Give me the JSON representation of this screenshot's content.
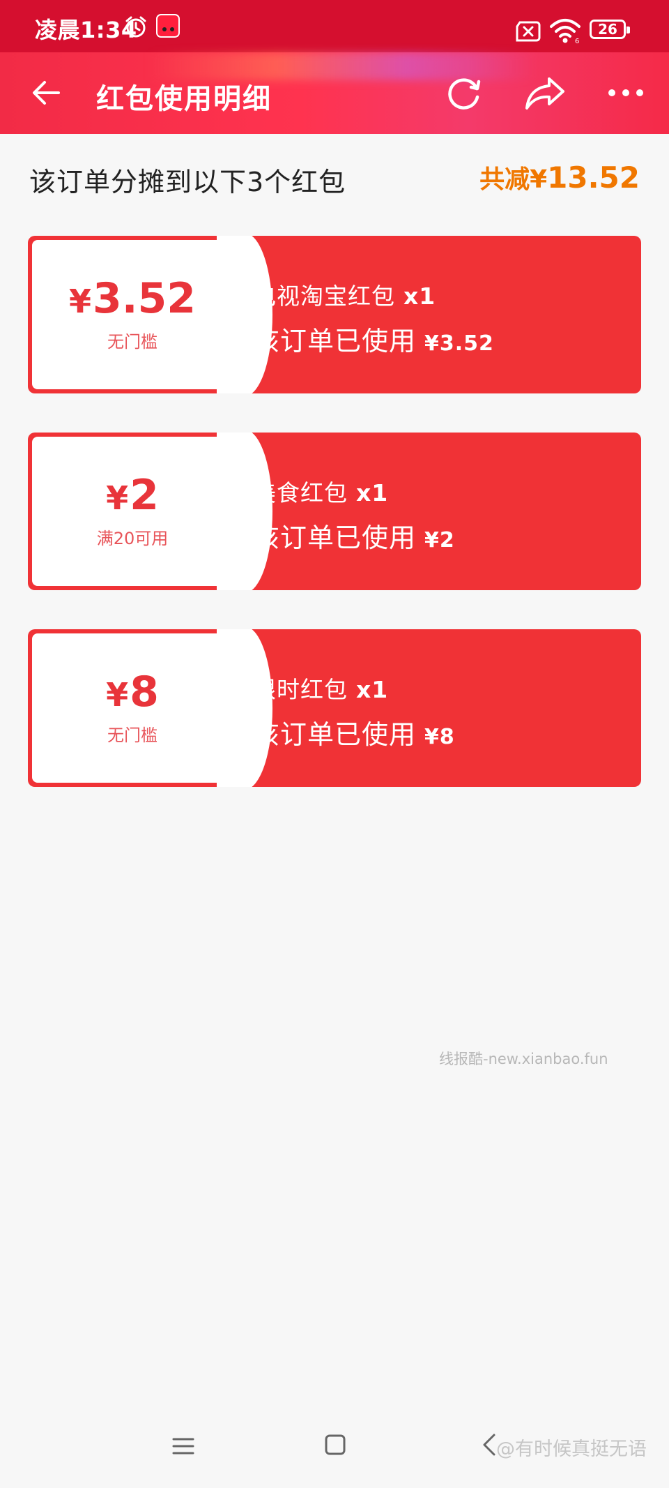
{
  "status_bar": {
    "time": "凌晨1:34",
    "battery_level": "26",
    "icons": [
      "alarm-icon",
      "tmall-app-icon",
      "no-sim-icon",
      "wifi-icon",
      "battery-icon"
    ]
  },
  "nav": {
    "title": "红包使用明细",
    "icons": [
      "back-arrow-icon",
      "refresh-icon",
      "share-icon",
      "more-icon"
    ]
  },
  "summary": {
    "text": "该订单分摊到以下3个红包",
    "total_prefix": "共减¥",
    "total_amount": "13.52",
    "accent_color": "#f07700"
  },
  "cards": [
    {
      "yen": "¥",
      "amount": "3.52",
      "condition": "无门槛",
      "name": "电视淘宝红包",
      "qty": "x1",
      "used_label": "该订单已使用",
      "used_value": "¥3.52"
    },
    {
      "yen": "¥",
      "amount": "2",
      "condition": "满20可用",
      "name": "美食红包",
      "qty": "x1",
      "used_label": "该订单已使用",
      "used_value": "¥2"
    },
    {
      "yen": "¥",
      "amount": "8",
      "condition": "无门槛",
      "name": "限时红包",
      "qty": "x1",
      "used_label": "该订单已使用",
      "used_value": "¥8"
    }
  ],
  "card_color": "#f03236",
  "watermark": "线报酷-new.xianbao.fun",
  "weibo_watermark": "@有时候真挺无语",
  "system_nav": {
    "icons": [
      "menu-icon",
      "home-icon",
      "back-icon"
    ]
  }
}
